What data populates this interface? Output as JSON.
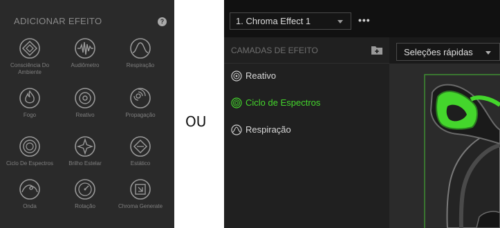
{
  "left_panel": {
    "title": "ADICIONAR EFEITO",
    "help_glyph": "?",
    "effects": [
      {
        "label": "Consciência Do Ambiente",
        "icon": "ambient-awareness-icon"
      },
      {
        "label": "Audiômetro",
        "icon": "audio-meter-icon"
      },
      {
        "label": "Respiração",
        "icon": "breathing-icon"
      },
      {
        "label": "Fogo",
        "icon": "fire-icon"
      },
      {
        "label": "Reativo",
        "icon": "reactive-icon"
      },
      {
        "label": "Propagação",
        "icon": "ripple-icon"
      },
      {
        "label": "Ciclo De Espectros",
        "icon": "spectrum-cycling-icon"
      },
      {
        "label": "Brilho Estelar",
        "icon": "starlight-icon"
      },
      {
        "label": "Estático",
        "icon": "static-icon"
      },
      {
        "label": "Onda",
        "icon": "wave-icon"
      },
      {
        "label": "Rotação",
        "icon": "wheel-icon"
      },
      {
        "label": "Chroma Generate",
        "icon": "chroma-generate-icon"
      }
    ]
  },
  "separator_text": "OU",
  "right_panel": {
    "profile_select": "1. Chroma Effect 1",
    "more_glyph": "•••",
    "layers_title": "CAMADAS DE EFEITO",
    "quick_select": "Seleções rápidas",
    "layers": [
      {
        "label": "Reativo",
        "icon": "reactive-icon",
        "active": false
      },
      {
        "label": "Ciclo de Espectros",
        "icon": "spectrum-cycling-icon",
        "active": true
      },
      {
        "label": "Respiração",
        "icon": "breathing-icon",
        "active": false
      }
    ]
  },
  "colors": {
    "accent": "#44d62c",
    "panel_bg": "#2a2a2a",
    "text_muted": "#808080"
  }
}
